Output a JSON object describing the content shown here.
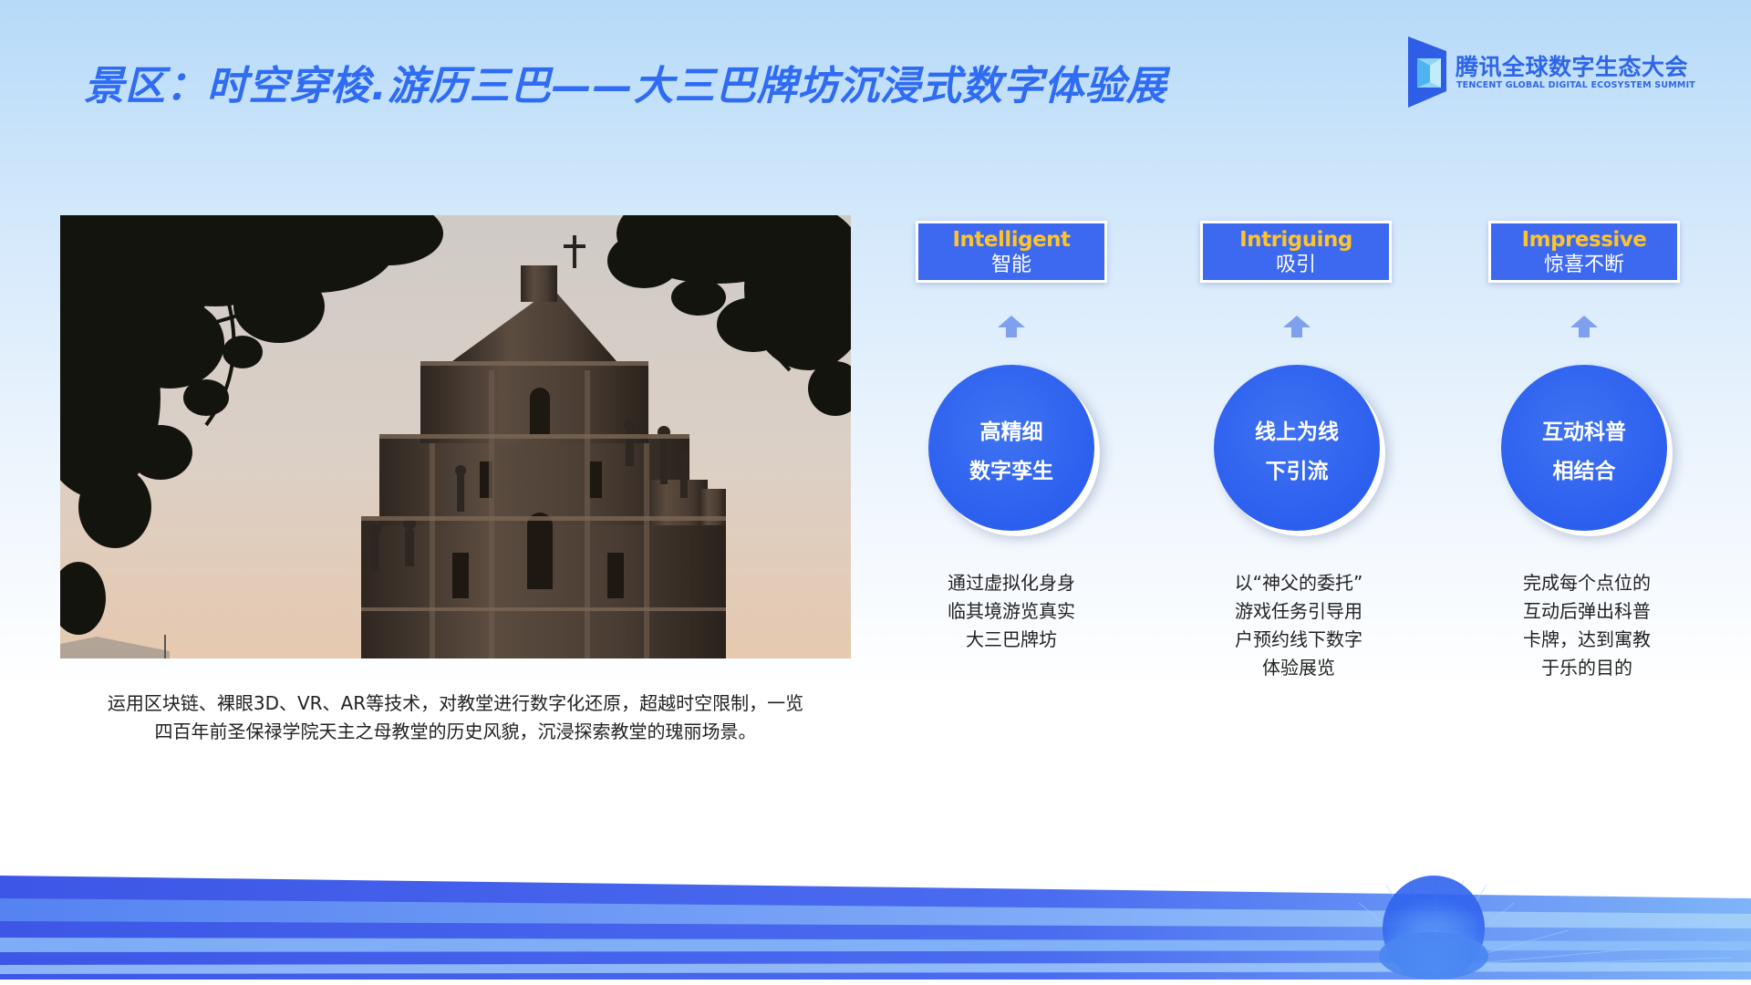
{
  "title": "景区：时空穿梭.游历三巴——大三巴牌坊沉浸式数字体验展",
  "logo": {
    "name_cn": "腾讯全球数字生态大会",
    "name_en": "TENCENT GLOBAL DIGITAL ECOSYSTEM SUMMIT"
  },
  "photo": {
    "subject": "Ruins of St. Paul's facade silhouetted against sunset sky with tree branches"
  },
  "caption": {
    "line1": "运用区块链、裸眼3D、VR、AR等技术，对教堂进行数字化还原，超越时空限制，一览",
    "line2": "四百年前圣保禄学院天主之母教堂的历史风貌，沉浸探索教堂的瑰丽场景。"
  },
  "features": [
    {
      "en": "Intelligent",
      "cn": "智能",
      "circle": [
        "高精细",
        "数字孪生"
      ],
      "desc": [
        "通过虚拟化身身",
        "临其境游览真实",
        "大三巴牌坊"
      ]
    },
    {
      "en": "Intriguing",
      "cn": "吸引",
      "circle": [
        "线上为线",
        "下引流"
      ],
      "desc": [
        "以“神父的委托”",
        "游戏任务引导用",
        "户预约线下数字",
        "体验展览"
      ]
    },
    {
      "en": "Impressive",
      "cn": "惊喜不断",
      "circle": [
        "互动科普",
        "相结合"
      ],
      "desc": [
        "完成每个点位的",
        "互动后弹出科普",
        "卡牌，达到寓教",
        "于乐的目的"
      ]
    }
  ],
  "colors": {
    "title": "#2f6cf3",
    "accent_blue": "#3d68f0",
    "badge_en": "#ffc428",
    "circle": "#2c5fee"
  },
  "icons": {
    "arrow": "arrow-up-icon",
    "logo": "tencent-summit-logo-icon"
  }
}
